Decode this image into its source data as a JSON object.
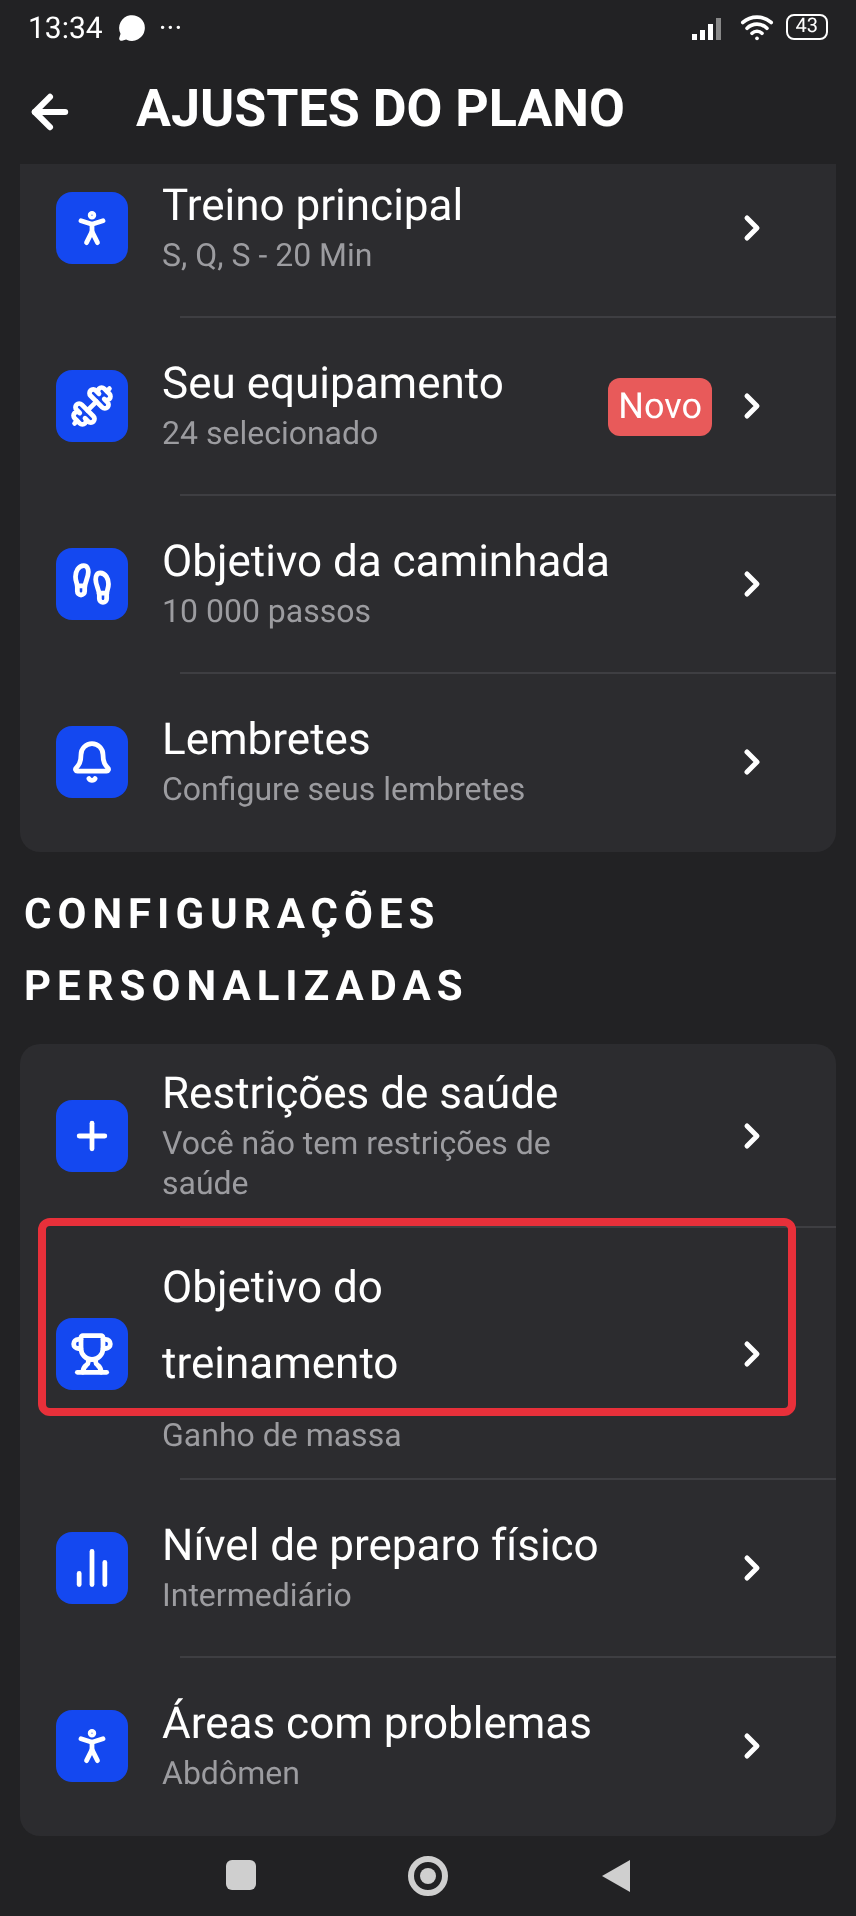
{
  "status_bar": {
    "time": "13:34",
    "more": "···",
    "battery": "43"
  },
  "header": {
    "title": "AJUSTES DO PLANO"
  },
  "plan_items": [
    {
      "title": "Treino principal",
      "subtitle": "S, Q, S - 20 Min"
    },
    {
      "title": "Seu equipamento",
      "subtitle": "24 selecionado",
      "badge": "Novo"
    },
    {
      "title": "Objetivo da caminhada",
      "subtitle": "10 000 passos"
    },
    {
      "title": "Lembretes",
      "subtitle": "Configure seus lembretes"
    }
  ],
  "section_title": "CONFIGURAÇÕES PERSONALIZADAS",
  "custom_items": [
    {
      "title": "Restrições de saúde",
      "subtitle": "Você não tem restrições de saúde",
      "highlighted": false
    },
    {
      "title": "Objetivo do treinamento",
      "subtitle": "Ganho de massa",
      "highlighted": true
    },
    {
      "title": "Nível de preparo físico",
      "subtitle": "Intermediário",
      "highlighted": false
    },
    {
      "title": "Áreas com problemas",
      "subtitle": "Abdômen",
      "highlighted": false
    }
  ]
}
